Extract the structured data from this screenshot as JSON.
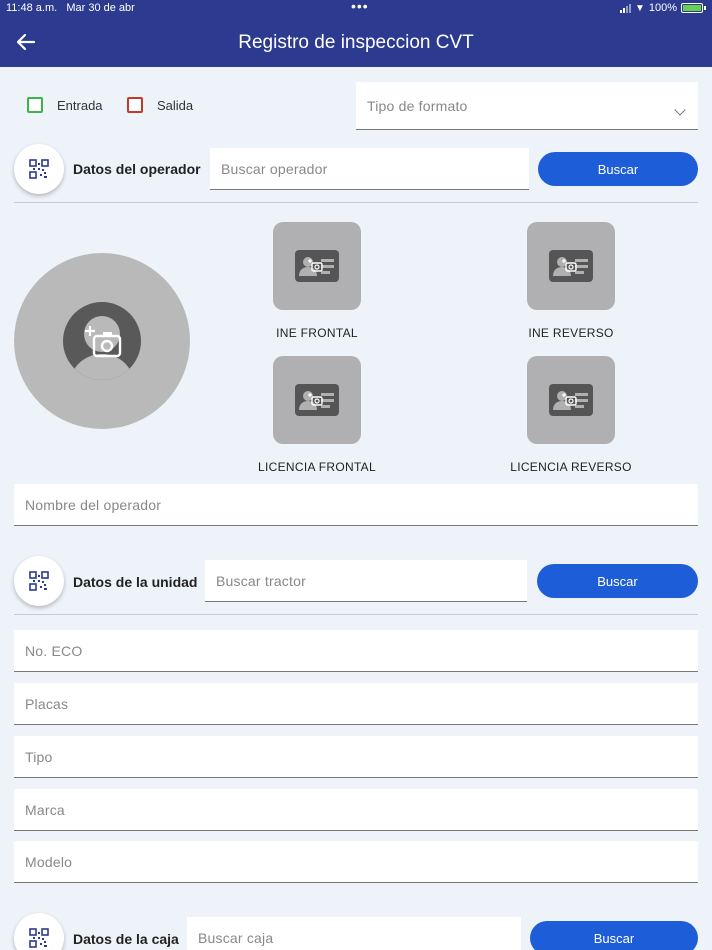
{
  "status_bar": {
    "time": "11:48 a.m.",
    "date": "Mar 30 de abr",
    "dots": "•••",
    "battery": "100%"
  },
  "header": {
    "title": "Registro de inspeccion CVT",
    "back_icon": "arrow-left-icon"
  },
  "movement": {
    "entrada_label": "Entrada",
    "salida_label": "Salida",
    "entrada_color": "#3bb54a",
    "salida_color": "#c0392b"
  },
  "format_select": {
    "placeholder": "Tipo de formato"
  },
  "operator": {
    "section_label": "Datos del operador",
    "search_placeholder": "Buscar operador",
    "search_button": "Buscar",
    "documents": [
      {
        "label": "INE FRONTAL"
      },
      {
        "label": "INE REVERSO"
      },
      {
        "label": "LICENCIA FRONTAL"
      },
      {
        "label": "LICENCIA REVERSO"
      }
    ],
    "name_placeholder": "Nombre del operador"
  },
  "unit": {
    "section_label": "Datos de la unidad",
    "search_placeholder": "Buscar tractor",
    "search_button": "Buscar",
    "fields": [
      {
        "placeholder": "No. ECO"
      },
      {
        "placeholder": "Placas"
      },
      {
        "placeholder": "Tipo"
      },
      {
        "placeholder": "Marca"
      },
      {
        "placeholder": "Modelo"
      }
    ]
  },
  "box": {
    "section_label": "Datos de la caja",
    "search_placeholder": "Buscar caja",
    "search_button": "Buscar"
  },
  "colors": {
    "header_bg": "#2c3a8f",
    "accent": "#1e5dd8",
    "page_bg": "#eef3fa"
  }
}
